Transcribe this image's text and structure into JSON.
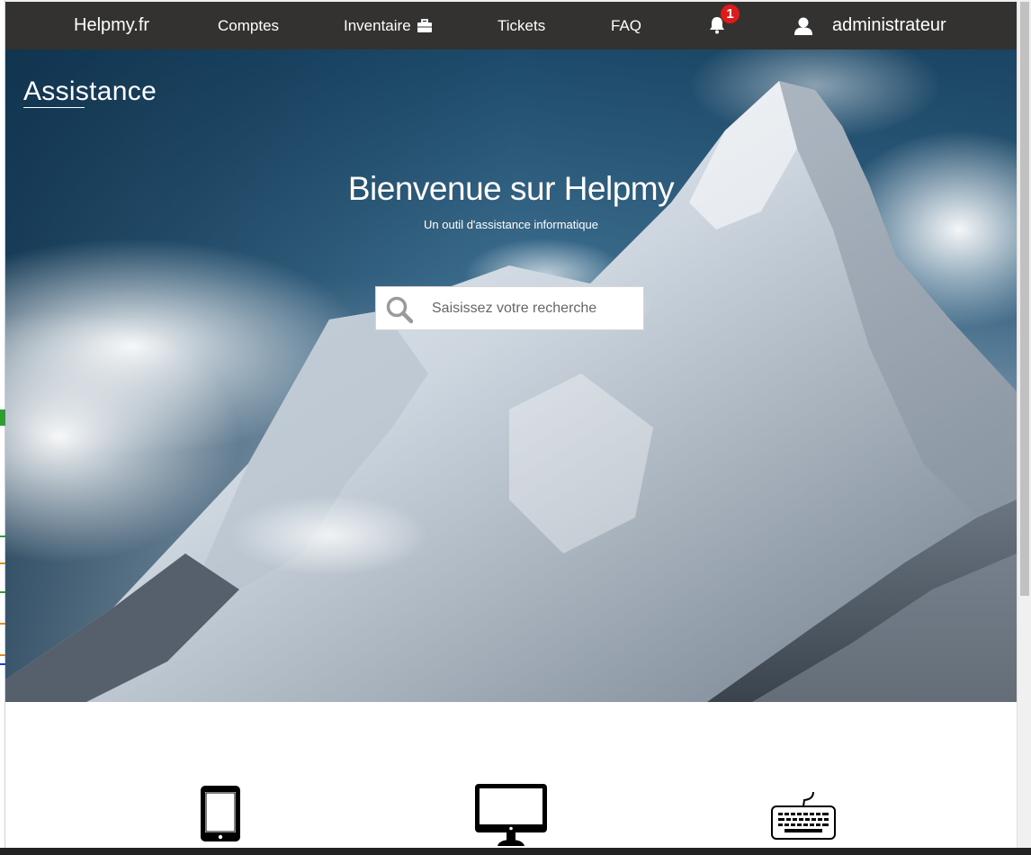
{
  "nav": {
    "brand": "Helpmy.fr",
    "items": [
      {
        "label": "Comptes"
      },
      {
        "label": "Inventaire"
      },
      {
        "label": "Tickets"
      },
      {
        "label": "FAQ"
      }
    ],
    "notification_count": "1",
    "user": "administrateur"
  },
  "hero": {
    "section_title": "Assistance",
    "welcome": "Bienvenue sur Helpmy",
    "subtitle": "Un outil d'assistance informatique"
  },
  "search": {
    "placeholder": "Saisissez votre recherche"
  },
  "features": [
    {
      "icon": "tablet-icon"
    },
    {
      "icon": "monitor-icon"
    },
    {
      "icon": "keyboard-icon"
    }
  ],
  "colors": {
    "navbar": "#333231",
    "badge": "#e01919",
    "text_on_dark": "#ffffff"
  }
}
